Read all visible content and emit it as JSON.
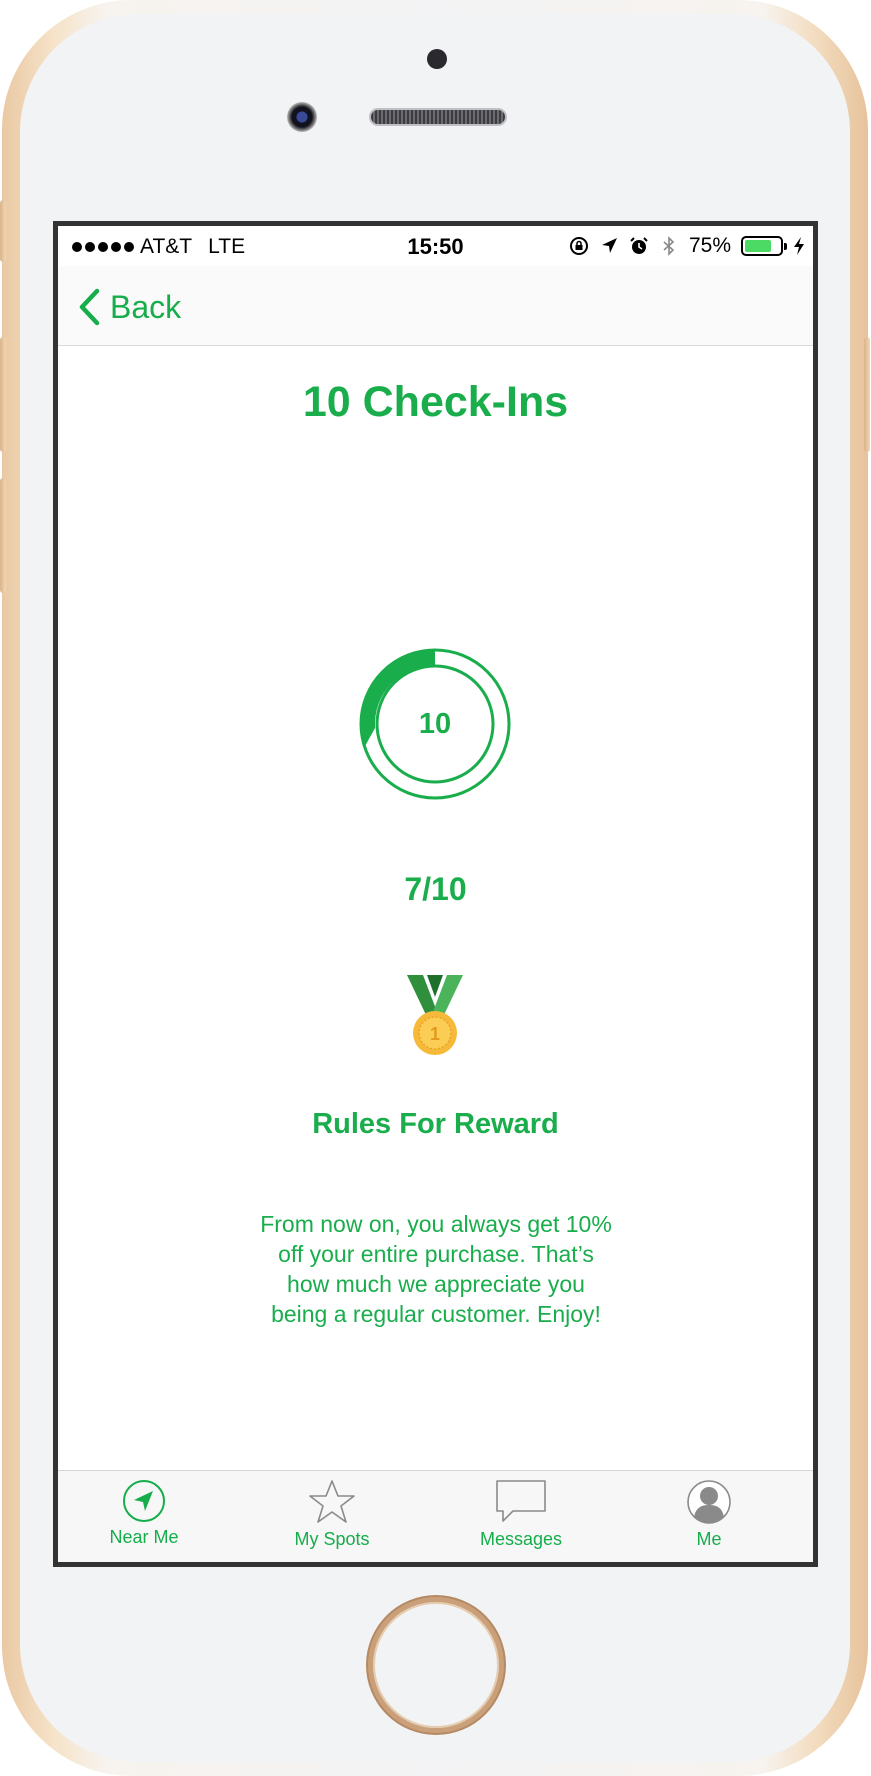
{
  "status_bar": {
    "carrier": "AT&T",
    "network": "LTE",
    "time": "15:50",
    "battery_percent": "75%",
    "battery_level": 0.75,
    "icons": [
      "orientation-lock-icon",
      "location-arrow-icon",
      "alarm-icon",
      "bluetooth-icon",
      "charging-bolt-icon"
    ]
  },
  "nav": {
    "back_label": "Back"
  },
  "reward": {
    "title": "10 Check-Ins",
    "ring_label": "10",
    "progress_text": "7/10",
    "progress_fraction": 0.7,
    "medal_icon": "first-place-medal-icon",
    "rules_title": "Rules For Reward",
    "rules_text": "From now on, you always get 10% off your entire purchase. That’s how much we appreciate you being a regular customer. Enjoy!"
  },
  "tabs": [
    {
      "label": "Near Me",
      "icon": "location-arrow-icon"
    },
    {
      "label": "My Spots",
      "icon": "star-icon"
    },
    {
      "label": "Messages",
      "icon": "chat-bubble-icon"
    },
    {
      "label": "Me",
      "icon": "user-avatar-icon"
    }
  ],
  "colors": {
    "accent": "#19ad4c",
    "frame": "#333333",
    "phone_gold": "#e9c9a3"
  }
}
